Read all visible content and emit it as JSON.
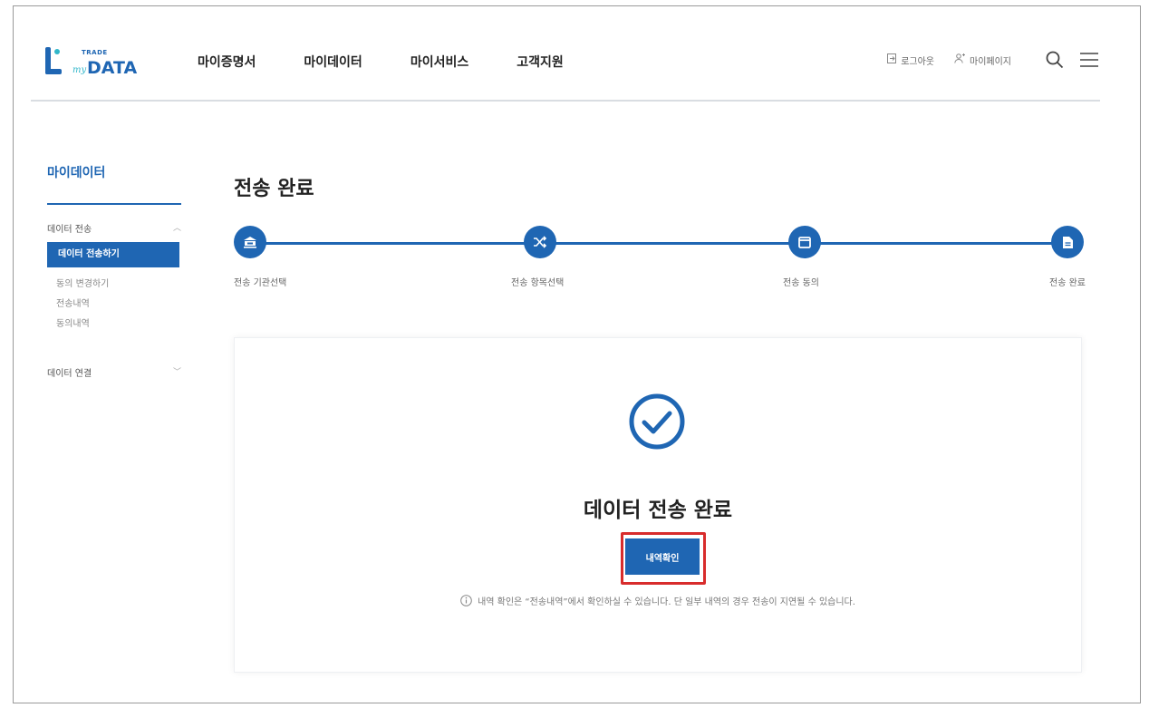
{
  "header": {
    "logo": {
      "small": "TRADE",
      "my": "my",
      "data": "DATA"
    },
    "nav": [
      "마이증명서",
      "마이데이터",
      "마이서비스",
      "고객지원"
    ],
    "util": {
      "logout": "로그아웃",
      "mypage": "마이페이지"
    }
  },
  "sidebar": {
    "title": "마이데이터",
    "group1": "데이터 전송",
    "items": [
      "데이터 전송하기",
      "동의 변경하기",
      "전송내역",
      "동의내역"
    ],
    "group2": "데이터 연결"
  },
  "main": {
    "title": "전송 완료",
    "steps": [
      "전송 기관선택",
      "전송 항목선택",
      "전송 동의",
      "전송 완료"
    ],
    "done_title": "데이터 전송 완료",
    "button_label": "내역확인",
    "notice": "내역 확인은 “전송내역”에서 확인하실 수 있습니다. 단 일부 내역의 경우 전송이 지연될 수 있습니다."
  },
  "colors": {
    "primary": "#1f66b3",
    "accent": "#30b6c9",
    "highlight": "#d82c2c"
  }
}
